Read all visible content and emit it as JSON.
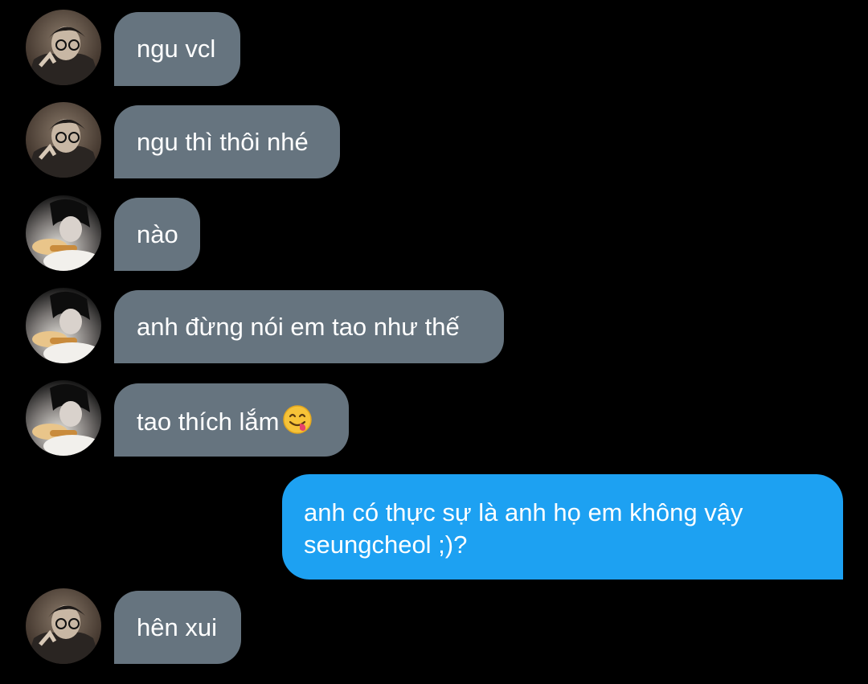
{
  "colors": {
    "background": "#000000",
    "incoming_bubble": "#66747f",
    "outgoing_bubble": "#1da1f2",
    "text": "#ffffff"
  },
  "messages": [
    {
      "direction": "incoming",
      "avatar": "avatar-a",
      "text": "ngu vcl"
    },
    {
      "direction": "incoming",
      "avatar": "avatar-a",
      "text": "ngu thì thôi nhé"
    },
    {
      "direction": "incoming",
      "avatar": "avatar-b",
      "text": "nào"
    },
    {
      "direction": "incoming",
      "avatar": "avatar-b",
      "text": "anh đừng nói em tao như thế"
    },
    {
      "direction": "incoming",
      "avatar": "avatar-b",
      "text": "tao thích lắm",
      "emoji": "face-savoring-food-emoji"
    },
    {
      "direction": "outgoing",
      "text": "anh có thực sự là anh họ em không vậy seungcheol ;)?"
    },
    {
      "direction": "incoming",
      "avatar": "avatar-a",
      "text": "hên xui"
    }
  ]
}
